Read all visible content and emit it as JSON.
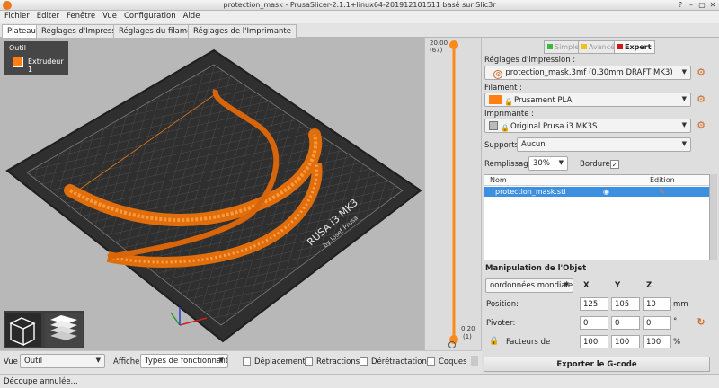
{
  "window": {
    "title": "protection_mask - PrusaSlicer-2.1.1+linux64-201912101511 basé sur Slic3r",
    "controls": [
      "?",
      "–",
      "▢",
      "✕"
    ]
  },
  "menu": [
    "Fichier",
    "Editer",
    "Fenêtre",
    "Vue",
    "Configuration",
    "Aide"
  ],
  "tabs": [
    "Plateau",
    "Réglages d'Impression",
    "Réglages du filament",
    "Réglages de l'Imprimante"
  ],
  "tool_panel": {
    "title": "Outil",
    "extruder": "Extrudeur 1",
    "extruder_color": "#ff7f10"
  },
  "bed": {
    "brand": "RUSA i3 MK3",
    "author": "by Josef Prusa"
  },
  "layer_slider": {
    "top_height": "20.00",
    "top_layer": "(67)",
    "bottom_height": "0.20",
    "bottom_layer": "(1)",
    "accent": "#ff8a1c",
    "range_fraction": 1.0
  },
  "modes": {
    "simple": "Simple",
    "advanced": "Avancé",
    "expert": "Expert",
    "simple_color": "#3cb93c",
    "advanced_color": "#f0c020",
    "expert_color": "#d01818"
  },
  "settings": {
    "print_label": "Réglages d'impression :",
    "print_value": "protection_mask.3mf (0.30mm DRAFT MK3)",
    "filament_label": "Filament :",
    "filament_value": "Prusament PLA",
    "filament_color": "#ff7f10",
    "printer_label": "Imprimante :",
    "printer_value": "Original Prusa i3 MK3S",
    "supports_label": "Supports:",
    "supports_value": "Aucun",
    "infill_label": "Remplissage:",
    "infill_value": "30%",
    "brim_label": "Bordure:",
    "brim_checked": "✓"
  },
  "object_list": {
    "col_name": "Nom",
    "col_edit": "Édition",
    "rows": [
      {
        "name": "protection_mask.stl"
      }
    ]
  },
  "manipulation": {
    "title": "Manipulation de l'Objet",
    "coord_system": "oordonnées mondiales",
    "axes": [
      "X",
      "Y",
      "Z"
    ],
    "position_label": "Position:",
    "position": [
      "125",
      "105",
      "10"
    ],
    "position_unit": "mm",
    "rotate_label": "Pivoter:",
    "rotation": [
      "0",
      "0",
      "0"
    ],
    "rotation_unit": "°",
    "scale_label": "Facteurs de",
    "scale": [
      "100",
      "100",
      "100"
    ],
    "scale_unit": "%"
  },
  "export_button": "Exporter le G-code",
  "bottom": {
    "view_label": "Vue",
    "view_value": "Outil",
    "show_label": "Afficher",
    "show_value": "Types de fonctionnalité",
    "checks": [
      "Déplacement",
      "Rétractions",
      "Dérétractation",
      "Coques"
    ]
  },
  "status": "Découpe annulée..."
}
